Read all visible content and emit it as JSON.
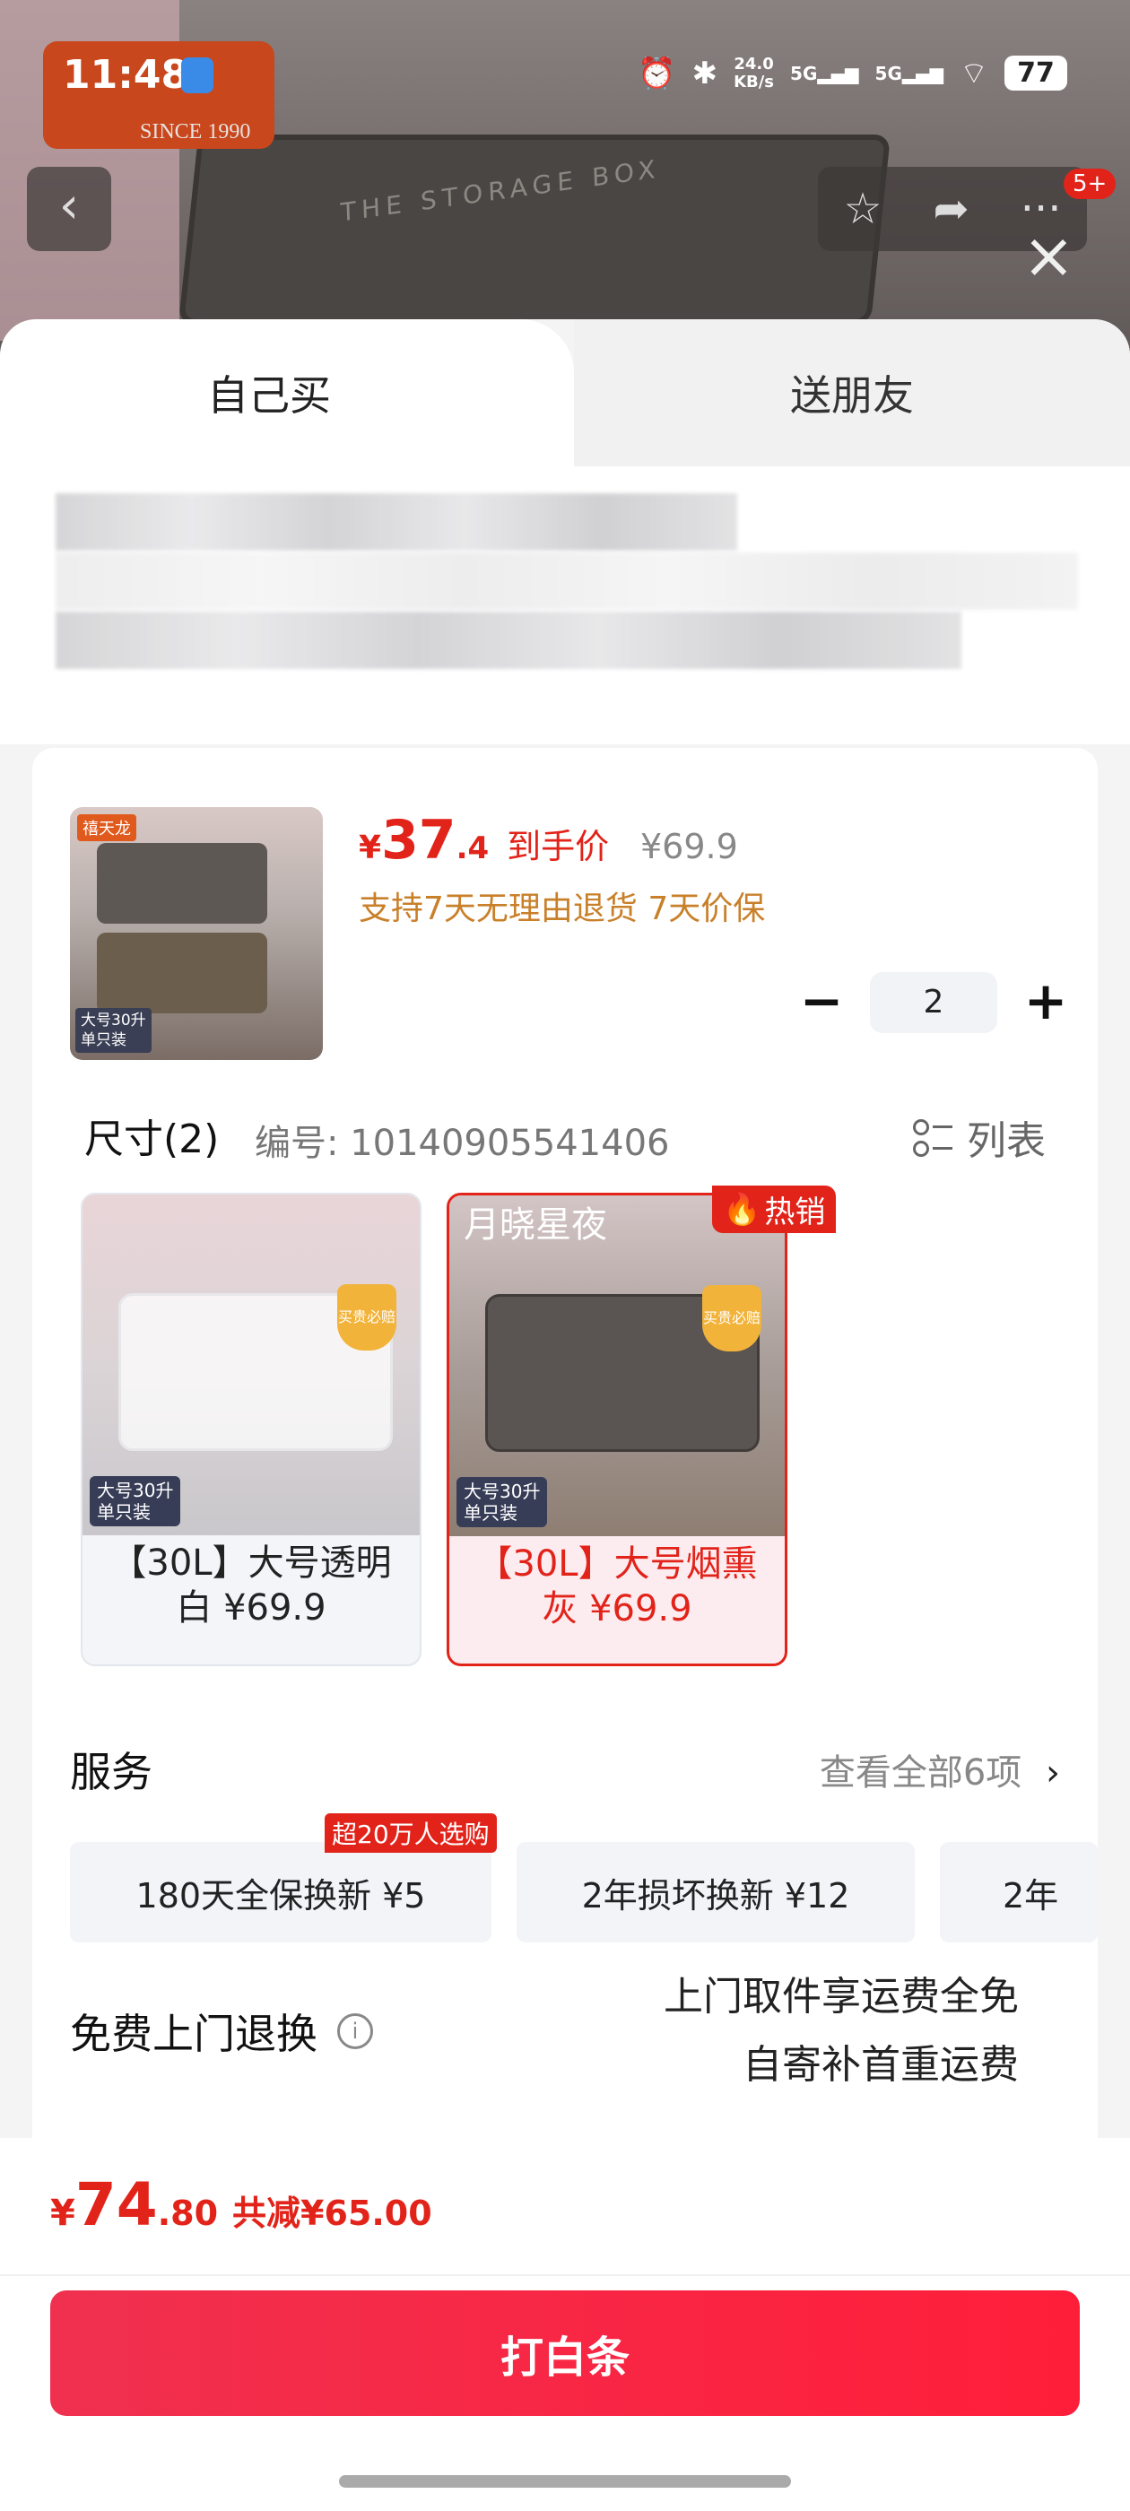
{
  "status_bar": {
    "time": "11:48",
    "network_speed_value": "24.0",
    "network_speed_unit": "KB/s",
    "signal1": "5G",
    "signal2": "5G",
    "battery": "77"
  },
  "background": {
    "brand_since": "SINCE 1990",
    "lid_text": "THE STORAGE BOX",
    "notification_badge": "5+"
  },
  "tabs": {
    "self": "自己买",
    "friend": "送朋友"
  },
  "product": {
    "price_currency": "¥",
    "price_int": "37",
    "price_dec": ".4",
    "price_label": "到手价",
    "original_price": "¥69.9",
    "guarantee": "支持7天无理由退货 7天价保",
    "quantity": "2",
    "thumb_tag": "禧天龙",
    "thumb_label_line1": "大号30升",
    "thumb_label_line2": "单只装"
  },
  "size": {
    "title": "尺寸(2)",
    "code": "编号: 10140905541406",
    "list_label": "列表",
    "options": [
      {
        "name": "【30L】大号透明白 ¥69.9",
        "badge_line1": "大号30升",
        "badge_line2": "单只装",
        "shield": "买贵必赔"
      },
      {
        "name": "【30L】大号烟熏灰 ¥69.9",
        "badge_line1": "大号30升",
        "badge_line2": "单只装",
        "shield": "买贵必赔",
        "overlay": "月晓星夜"
      }
    ],
    "hot_label": "热销"
  },
  "service": {
    "title": "服务",
    "view_all": "查看全部6项",
    "chips": [
      "180天全保换新 ¥5",
      "2年损坏换新 ¥12",
      "2年"
    ],
    "chip_badge": "超20万人选购"
  },
  "returns": {
    "title": "免费上门退换",
    "line1": "上门取件享运费全免",
    "line2": "自寄补首重运费"
  },
  "footer": {
    "total_currency": "¥",
    "total_int": "74",
    "total_dec": ".80",
    "savings": "共减¥65.00",
    "buy_button": "打白条"
  },
  "colors": {
    "accent": "#e2231a",
    "gold": "#c9802a"
  }
}
